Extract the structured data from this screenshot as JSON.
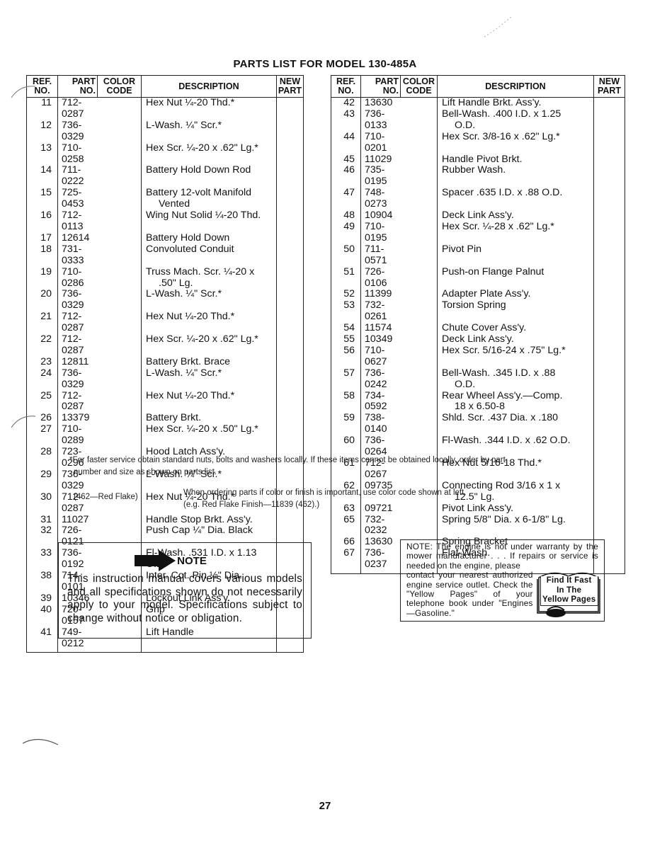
{
  "page": {
    "title": "PARTS LIST FOR MODEL 130-485A",
    "page_number": "27"
  },
  "table_headers": {
    "ref_no_line1": "REF.",
    "ref_no_line2": "NO.",
    "part_no_line1": "PART",
    "part_no_line2": "NO.",
    "color_code_line1": "COLOR",
    "color_code_line2": "CODE",
    "description": "DESCRIPTION",
    "new_part_line1": "NEW",
    "new_part_line2": "PART"
  },
  "left_table": {
    "rows": [
      {
        "ref": "11",
        "part": "712-0287",
        "color": "",
        "desc": "Hex Nut ¼-20 Thd.*",
        "desc2": ""
      },
      {
        "ref": "12",
        "part": "736-0329",
        "color": "",
        "desc": "L-Wash. ¼\" Scr.*",
        "desc2": ""
      },
      {
        "ref": "13",
        "part": "710-0258",
        "color": "",
        "desc": "Hex Scr. ¼-20 x .62\" Lg.*",
        "desc2": ""
      },
      {
        "ref": "14",
        "part": "711-0222",
        "color": "",
        "desc": "Battery Hold Down Rod",
        "desc2": ""
      },
      {
        "ref": "15",
        "part": "725-0453",
        "color": "",
        "desc": "Battery 12-volt Manifold",
        "desc2": "Vented"
      },
      {
        "ref": "16",
        "part": "712-0113",
        "color": "",
        "desc": "Wing Nut Solid ¼-20 Thd.",
        "desc2": ""
      },
      {
        "ref": "17",
        "part": "12614",
        "color": "",
        "desc": "Battery Hold Down",
        "desc2": ""
      },
      {
        "ref": "18",
        "part": "731-0333",
        "color": "",
        "desc": "Convoluted Conduit",
        "desc2": ""
      },
      {
        "ref": "19",
        "part": "710-0286",
        "color": "",
        "desc": "Truss Mach. Scr. ¼-20 x",
        "desc2": ".50\" Lg."
      },
      {
        "ref": "20",
        "part": "736-0329",
        "color": "",
        "desc": "L-Wash. ¼\" Scr.*",
        "desc2": ""
      },
      {
        "ref": "21",
        "part": "712-0287",
        "color": "",
        "desc": "Hex Nut ¼-20 Thd.*",
        "desc2": ""
      },
      {
        "ref": "22",
        "part": "712-0287",
        "color": "",
        "desc": "Hex Scr. ¼-20 x .62\" Lg.*",
        "desc2": ""
      },
      {
        "ref": "23",
        "part": "12811",
        "color": "",
        "desc": "Battery Brkt. Brace",
        "desc2": ""
      },
      {
        "ref": "24",
        "part": "736-0329",
        "color": "",
        "desc": "L-Wash. ¼\" Scr.*",
        "desc2": ""
      },
      {
        "ref": "25",
        "part": "712-0287",
        "color": "",
        "desc": "Hex Nut ¼-20 Thd.*",
        "desc2": ""
      },
      {
        "ref": "26",
        "part": "13379",
        "color": "",
        "desc": "Battery Brkt.",
        "desc2": ""
      },
      {
        "ref": "27",
        "part": "710-0289",
        "color": "",
        "desc": "Hex Scr. ¼-20 x .50\" Lg.*",
        "desc2": ""
      },
      {
        "ref": "28",
        "part": "723-0296",
        "color": "",
        "desc": "Hood Latch Ass'y.",
        "desc2": ""
      },
      {
        "ref": "29",
        "part": "736-0329",
        "color": "",
        "desc": "L-Wash. ¼\" Scr.*",
        "desc2": ""
      },
      {
        "ref": "30",
        "part": "712-0287",
        "color": "",
        "desc": "Hex Nut ¼-20 Thd.*",
        "desc2": ""
      },
      {
        "ref": "31",
        "part": "11027",
        "color": "",
        "desc": "Handle Stop Brkt. Ass'y.",
        "desc2": ""
      },
      {
        "ref": "32",
        "part": "726-0121",
        "color": "",
        "desc": "Push Cap ¼\" Dia. Black",
        "desc2": ""
      },
      {
        "ref": "33",
        "part": "736-0192",
        "color": "",
        "desc": "Fl-Wash. .531 I.D. x 1.13 O.D.",
        "desc2": ""
      },
      {
        "ref": "38",
        "part": "714-0101",
        "color": "",
        "desc": "Inter. Cot. Pin ½\" Dia.",
        "desc2": ""
      },
      {
        "ref": "39",
        "part": "10346",
        "color": "",
        "desc": "Lockout Link Ass'y.",
        "desc2": ""
      },
      {
        "ref": "40",
        "part": "720-0157",
        "color": "",
        "desc": "Grip",
        "desc2": ""
      },
      {
        "ref": "41",
        "part": "749-0212",
        "color": "",
        "desc": "Lift Handle",
        "desc2": ""
      }
    ]
  },
  "right_table": {
    "rows": [
      {
        "ref": "42",
        "part": "13630",
        "color": "",
        "desc": "Lift Handle Brkt. Ass'y.",
        "desc2": ""
      },
      {
        "ref": "43",
        "part": "736-0133",
        "color": "",
        "desc": "Bell-Wash. .400 I.D. x 1.25",
        "desc2": "O.D."
      },
      {
        "ref": "44",
        "part": "710-0201",
        "color": "",
        "desc": "Hex Scr. 3/8-16 x .62\" Lg.*",
        "desc2": ""
      },
      {
        "ref": "45",
        "part": "11029",
        "color": "",
        "desc": "Handle Pivot Brkt.",
        "desc2": ""
      },
      {
        "ref": "46",
        "part": "735-0195",
        "color": "",
        "desc": "Rubber Wash.",
        "desc2": ""
      },
      {
        "ref": "47",
        "part": "748-0273",
        "color": "",
        "desc": "Spacer .635 I.D. x .88 O.D.",
        "desc2": ""
      },
      {
        "ref": "48",
        "part": "10904",
        "color": "",
        "desc": "Deck Link Ass'y.",
        "desc2": ""
      },
      {
        "ref": "49",
        "part": "710-0195",
        "color": "",
        "desc": "Hex Scr. ¼-28 x .62\" Lg.*",
        "desc2": ""
      },
      {
        "ref": "50",
        "part": "711-0571",
        "color": "",
        "desc": "Pivot Pin",
        "desc2": ""
      },
      {
        "ref": "51",
        "part": "726-0106",
        "color": "",
        "desc": "Push-on Flange Palnut",
        "desc2": ""
      },
      {
        "ref": "52",
        "part": "11399",
        "color": "",
        "desc": "Adapter Plate Ass'y.",
        "desc2": ""
      },
      {
        "ref": "53",
        "part": "732-0261",
        "color": "",
        "desc": "Torsion Spring",
        "desc2": ""
      },
      {
        "ref": "54",
        "part": "11574",
        "color": "",
        "desc": "Chute Cover Ass'y.",
        "desc2": ""
      },
      {
        "ref": "55",
        "part": "10349",
        "color": "",
        "desc": "Deck Link Ass'y.",
        "desc2": ""
      },
      {
        "ref": "56",
        "part": "710-0627",
        "color": "",
        "desc": "Hex Scr. 5/16-24 x .75\" Lg.*",
        "desc2": ""
      },
      {
        "ref": "57",
        "part": "736-0242",
        "color": "",
        "desc": "Bell-Wash. .345 I.D. x .88",
        "desc2": "O.D."
      },
      {
        "ref": "58",
        "part": "734-0592",
        "color": "",
        "desc": "Rear Wheel Ass'y.—Comp.",
        "desc2": "18 x 6.50-8"
      },
      {
        "ref": "59",
        "part": "738-0140",
        "color": "",
        "desc": "Shld. Scr. .437 Dia. x .180",
        "desc2": ""
      },
      {
        "ref": "60",
        "part": "736-0264",
        "color": "",
        "desc": "Fl-Wash. .344 I.D. x .62 O.D.",
        "desc2": ""
      },
      {
        "ref": "61",
        "part": "712-0267",
        "color": "",
        "desc": "Hex Nut 5/16-18 Thd.*",
        "desc2": ""
      },
      {
        "ref": "62",
        "part": "09735",
        "color": "",
        "desc": "Connecting Rod 3/16 x 1 x",
        "desc2": "12.5\" Lg."
      },
      {
        "ref": "63",
        "part": "09721",
        "color": "",
        "desc": "Pivot Link Ass'y.",
        "desc2": ""
      },
      {
        "ref": "65",
        "part": "732-0232",
        "color": "",
        "desc": "Spring 5/8\" Dia. x 6-1/8\" Lg.",
        "desc2": ""
      },
      {
        "ref": "66",
        "part": "13630",
        "color": "",
        "desc": "Spring Bracket",
        "desc2": ""
      },
      {
        "ref": "67",
        "part": "736-0237",
        "color": "",
        "desc": "Flat-Wash.",
        "desc2": ""
      }
    ]
  },
  "footnotes": {
    "asterisk_line1": "*For faster service obtain standard nuts, bolts and washers locally. If these items cannot be obtained locally, order by part",
    "asterisk_line2": "number and size as shown on parts list.",
    "color_code_label": "(462—Red Flake)",
    "color_code_line1": "When ordering parts if color or finish is important, use color code shown at left.",
    "color_code_line2": "(e.g. Red Flake Finish—11839 (462).)"
  },
  "note_box": {
    "icon": "arrow-right-icon",
    "title": "NOTE",
    "body": "This instruction manual covers various models and all specifications shown do not necessarily apply to your model. Specifications subject to change without notice or obligation."
  },
  "engine_box": {
    "top_text": "NOTE: The engine is not under warranty by the mower manufacturer . . . If repairs or service is needed on the engine, please",
    "left_text": "contact your nearest authorized engine service outlet. Check the \"Yellow Pages\" of your telephone book under \"Engines—Gasoline.\"",
    "badge_line1": "Find It Fast",
    "badge_line2": "In The",
    "badge_line3": "Yellow Pages",
    "icon": "telephone-book-icon"
  }
}
